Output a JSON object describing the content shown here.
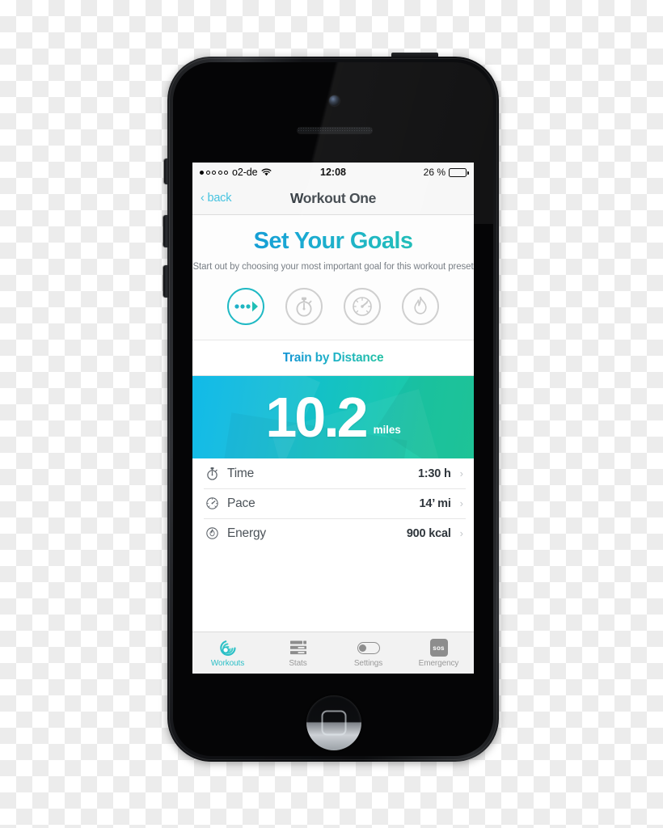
{
  "device": {
    "name": "iphone-5-black",
    "hardware": {
      "silent_switch": "silent-switch",
      "volume_up": "volume-up-button",
      "volume_down": "volume-down-button",
      "power": "power-button",
      "home": "home-button",
      "camera": "front-camera",
      "earpiece": "earpiece-speaker"
    }
  },
  "status_bar": {
    "signal_dots_total": 5,
    "signal_dots_filled": 1,
    "carrier": "o2-de",
    "wifi_icon": "wifi-icon",
    "time": "12:08",
    "battery_percent": "26 %",
    "battery_level": 26
  },
  "nav": {
    "back_label": "‹ back",
    "title": "Workout One"
  },
  "header": {
    "headline": "Set Your Goals",
    "subtitle": "Start out by choosing your most important goal for this workout preset"
  },
  "goal_icons": [
    {
      "name": "distance-icon",
      "label": "Distance",
      "active": true
    },
    {
      "name": "stopwatch-icon",
      "label": "Time",
      "active": false
    },
    {
      "name": "speedometer-icon",
      "label": "Pace",
      "active": false
    },
    {
      "name": "flame-icon",
      "label": "Energy",
      "active": false
    }
  ],
  "mode_label": "Train by Distance",
  "hero": {
    "value": "10.2",
    "unit": "miles"
  },
  "details": [
    {
      "icon": "stopwatch-icon",
      "label": "Time",
      "value": "1:30 h",
      "chevron": "›"
    },
    {
      "icon": "speedometer-icon",
      "label": "Pace",
      "value": "14’ mi",
      "chevron": "›"
    },
    {
      "icon": "flame-icon",
      "label": "Energy",
      "value": "900 kcal",
      "chevron": "›"
    }
  ],
  "tabs": [
    {
      "name": "workouts",
      "label": "Workouts",
      "icon": "workouts-swirl-icon",
      "active": true
    },
    {
      "name": "stats",
      "label": "Stats",
      "icon": "stats-bars-icon",
      "active": false
    },
    {
      "name": "settings",
      "label": "Settings",
      "icon": "toggle-icon",
      "active": false
    },
    {
      "name": "emergency",
      "label": "Emergency",
      "icon": "sos-icon",
      "badge": "sos",
      "active": false
    }
  ],
  "colors": {
    "accent_blue": "#00b5e8",
    "accent_teal": "#20cc9d",
    "active_tab": "#2bbfc7",
    "back_link": "#46c3e0",
    "nav_title": "#3b4248",
    "inactive_gray": "#9a9a9a"
  }
}
